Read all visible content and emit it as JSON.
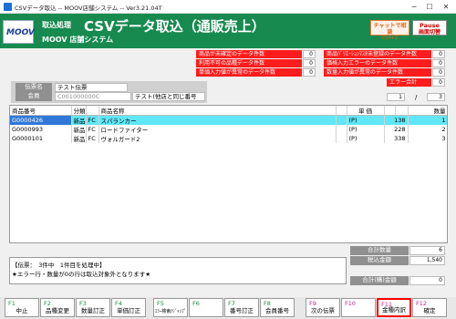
{
  "window": {
    "title": "CSVデータ取込 -- MOOV店舗システム -- Ver3.21.04T",
    "minimize": "─",
    "maximize": "☐",
    "close": "✕"
  },
  "header": {
    "logo": "MOOV",
    "section": "取込処理",
    "title": "CSVデータ取込（通販売上）",
    "subtitle": "MOOV 店舗システム",
    "chat_button": "チャットで相談",
    "chat_shortcut": "Ctrl+Z",
    "pause_button_top": "Pause",
    "pause_button_bottom": "画面切替"
  },
  "errors": {
    "left": [
      {
        "label": "商品が未確定のデータ件数",
        "count": "0"
      },
      {
        "label": "利用不可の品種データ件数",
        "count": "0"
      },
      {
        "label": "単価入力値が異常のデータ件数",
        "count": "0"
      }
    ],
    "right": [
      {
        "label": "商品ﾊﾞﾘｴｰｼｮﾝﾏｽﾀ未登録のデータ件数",
        "count": "0"
      },
      {
        "label": "価格入力エラーのデータ件数",
        "count": "0"
      },
      {
        "label": "数量入力値が異常のデータ件数",
        "count": "0"
      }
    ],
    "total_label": "エラー合計",
    "total_count": "0"
  },
  "slip": {
    "slip_label": "伝票名",
    "slip_value": "テスト伝票",
    "member_label": "会員",
    "member_code": "C001000000C",
    "member_name": "テスト(他店と同じ番号"
  },
  "paging": {
    "current": "1",
    "separator": "/",
    "total": "3"
  },
  "table": {
    "headers": {
      "code": "商品番号",
      "cat1": "分類",
      "cat2": "",
      "name": "商品名称",
      "unit": "単 価",
      "qty": "数量"
    },
    "rows": [
      {
        "code": "G0000426",
        "cat1": "新品",
        "cat2": "FC",
        "name": "スパランカー",
        "unit_tag": "(P)",
        "price": "138",
        "qty": "1"
      },
      {
        "code": "G0000993",
        "cat1": "新品",
        "cat2": "FC",
        "name": "ロードファイター",
        "unit_tag": "(P)",
        "price": "228",
        "qty": "2"
      },
      {
        "code": "G0000101",
        "cat1": "新品",
        "cat2": "FC",
        "name": "ヴォルガード2",
        "unit_tag": "(P)",
        "price": "338",
        "qty": "3"
      }
    ]
  },
  "summary": {
    "qty_label": "合計数量",
    "qty_value": "6",
    "tax_label": "税込金額",
    "tax_value": "1,540",
    "pay_label": "合計(購)金額",
    "pay_value": "0"
  },
  "message": {
    "line1": "【伝票：　3件中　1件目を処理中】",
    "line2": "★エラー行・数量が0の行は取込対象外となります★"
  },
  "fkeys": [
    {
      "key": "F1",
      "label": "中止"
    },
    {
      "key": "F2",
      "label": "品種変更"
    },
    {
      "key": "F3",
      "label": "数量訂正"
    },
    {
      "key": "F4",
      "label": "単価訂正"
    },
    {
      "key": "F5",
      "label": "ｴﾗｰ検索/ｼﾞｬﾝﾌﾟ"
    },
    {
      "key": "F6",
      "label": ""
    },
    {
      "key": "F7",
      "label": "番号訂正"
    },
    {
      "key": "F8",
      "label": "会員番号"
    },
    {
      "key": "F9",
      "label": "次の伝票"
    },
    {
      "key": "F10",
      "label": ""
    },
    {
      "key": "F11",
      "label": "金種内訳"
    },
    {
      "key": "F12",
      "label": "確定"
    }
  ],
  "colors": {
    "header": "#178a4f",
    "error": "#ff1c1c",
    "selected_row": "#2f78d8",
    "highlight_row": "#5fe7f5",
    "fkey_highlight": "#ff0000"
  }
}
